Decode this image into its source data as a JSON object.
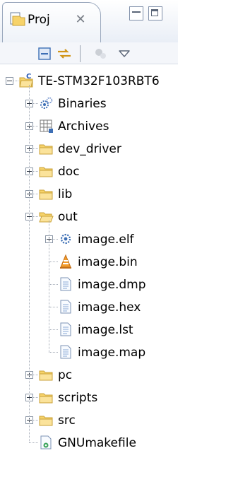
{
  "view": {
    "tab_label": "Proj",
    "close_symbol": "✕"
  },
  "icons": {
    "project_explorer": "project-explorer-icon",
    "collapse_all": "collapse-all-icon",
    "link_with_editor": "link-with-editor-icon",
    "filter": "filter-icon",
    "view_menu": "chevron-down-icon"
  },
  "tree": {
    "project": {
      "label": "TE-STM32F103RBT6",
      "icon": "c-project-folder-icon",
      "expanded": true
    },
    "items": [
      {
        "label": "Binaries",
        "icon": "binaries-icon",
        "expanded": false
      },
      {
        "label": "Archives",
        "icon": "archives-icon",
        "expanded": false
      },
      {
        "label": "dev_driver",
        "icon": "folder-icon",
        "expanded": false
      },
      {
        "label": "doc",
        "icon": "folder-icon",
        "expanded": false
      },
      {
        "label": "lib",
        "icon": "folder-icon",
        "expanded": false
      },
      {
        "label": "out",
        "icon": "folder-open-icon",
        "expanded": true,
        "children": [
          {
            "label": "image.elf",
            "icon": "binary-file-icon",
            "expandable": true
          },
          {
            "label": "image.bin",
            "icon": "cone-file-icon"
          },
          {
            "label": "image.dmp",
            "icon": "text-file-icon"
          },
          {
            "label": "image.hex",
            "icon": "text-file-icon"
          },
          {
            "label": "image.lst",
            "icon": "text-file-icon"
          },
          {
            "label": "image.map",
            "icon": "text-file-icon"
          }
        ]
      },
      {
        "label": "pc",
        "icon": "folder-icon",
        "expanded": false
      },
      {
        "label": "scripts",
        "icon": "folder-icon",
        "expanded": false
      },
      {
        "label": "src",
        "icon": "folder-icon",
        "expanded": false
      },
      {
        "label": "GNUmakefile",
        "icon": "makefile-icon"
      }
    ]
  },
  "colors": {
    "folder": "#f7d36a",
    "folder_border": "#c9a238",
    "tab_border": "#9aa8bd",
    "tree_line": "#a6adb8"
  }
}
